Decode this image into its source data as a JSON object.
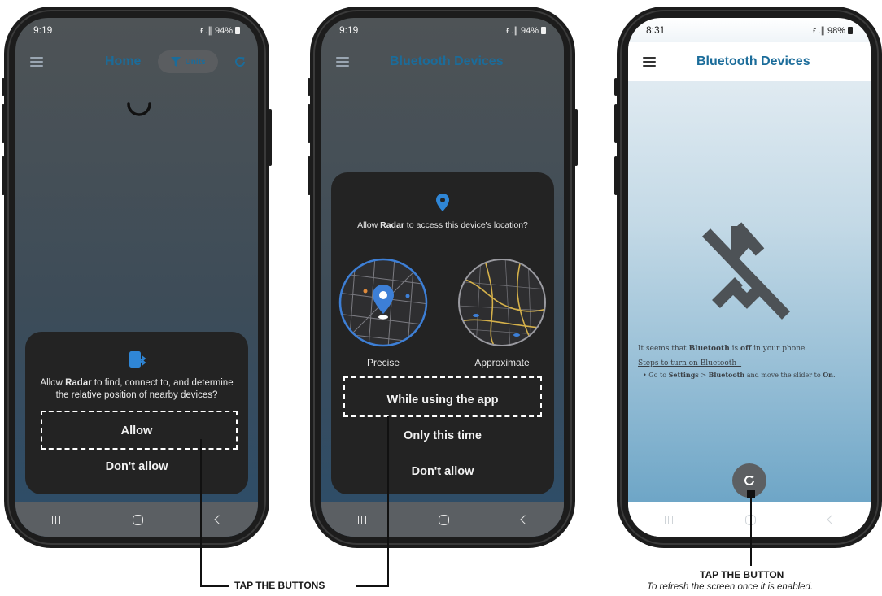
{
  "phone1": {
    "status": {
      "time": "9:19",
      "indicators": "ғ .∥ 94%"
    },
    "appbar": {
      "title": "Home",
      "units_label": "Units"
    },
    "dialog": {
      "text_before": "Allow ",
      "app_name": "Radar",
      "text_after": " to find, connect to, and determine the relative position of nearby devices?",
      "allow": "Allow",
      "deny": "Don't allow"
    }
  },
  "phone2": {
    "status": {
      "time": "9:19",
      "indicators": "ғ .∥ 94%"
    },
    "appbar": {
      "title": "Bluetooth Devices"
    },
    "dialog": {
      "text_before": "Allow ",
      "app_name": "Radar",
      "text_after": " to access this device's location?",
      "precise": "Precise",
      "approximate": "Approximate",
      "while_using": "While using the app",
      "only_this_time": "Only this time",
      "deny": "Don't allow"
    }
  },
  "phone3": {
    "status": {
      "time": "8:31",
      "indicators": "ғ .∥ 98%"
    },
    "appbar": {
      "title": "Bluetooth Devices"
    },
    "message": {
      "line1_before": "It seems that ",
      "line1_bold": "Bluetooth",
      "line1_mid": " is ",
      "line1_bold2": "off",
      "line1_after": " in your phone.",
      "steps_title": "Steps to turn on Bluetooth :",
      "step_before": "• Go to ",
      "step_settings": "Settings",
      "step_gt": " > ",
      "step_bluetooth": "Bluetooth",
      "step_mid": " and move the slider to ",
      "step_on": "On",
      "step_end": "."
    }
  },
  "captions": {
    "tap_buttons": "TAP THE BUTTONS",
    "tap_button": "TAP THE BUTTON",
    "refresh_hint": "To refresh the screen once it is enabled."
  },
  "icons": {
    "menu": "hamburger-menu-icon",
    "filter": "filter-funnel-icon",
    "refresh": "refresh-icon",
    "bluetooth_perm": "bluetooth-device-permission-icon",
    "location": "location-pin-icon",
    "bluetooth_off": "bluetooth-disabled-icon"
  },
  "colors": {
    "title_blue": "#1b6c9a",
    "dialog_bg": "#232323",
    "accent": "#2f86d6"
  }
}
